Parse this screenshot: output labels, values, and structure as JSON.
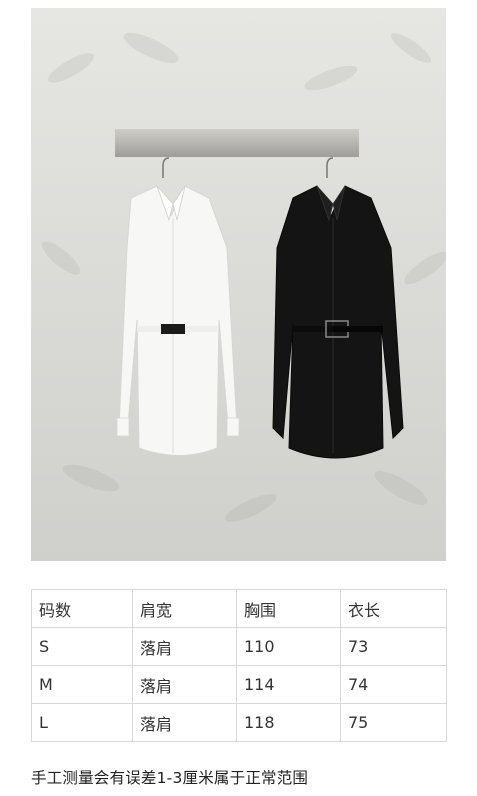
{
  "photo": {
    "subject": "white and black belted shirts hanging on a wall rail",
    "colors": {
      "wall": "#d9d9d6",
      "rail": "#b8b6b1",
      "white_shirt": "#f7f7f5",
      "black_shirt": "#141414"
    }
  },
  "size_table": {
    "headers": [
      "码数",
      "肩宽",
      "胸围",
      "衣长"
    ],
    "rows": [
      [
        "S",
        "落肩",
        "110",
        "73"
      ],
      [
        "M",
        "落肩",
        "114",
        "74"
      ],
      [
        "L",
        "落肩",
        "118",
        "75"
      ]
    ]
  },
  "note": "手工测量会有误差1-3厘米属于正常范围"
}
